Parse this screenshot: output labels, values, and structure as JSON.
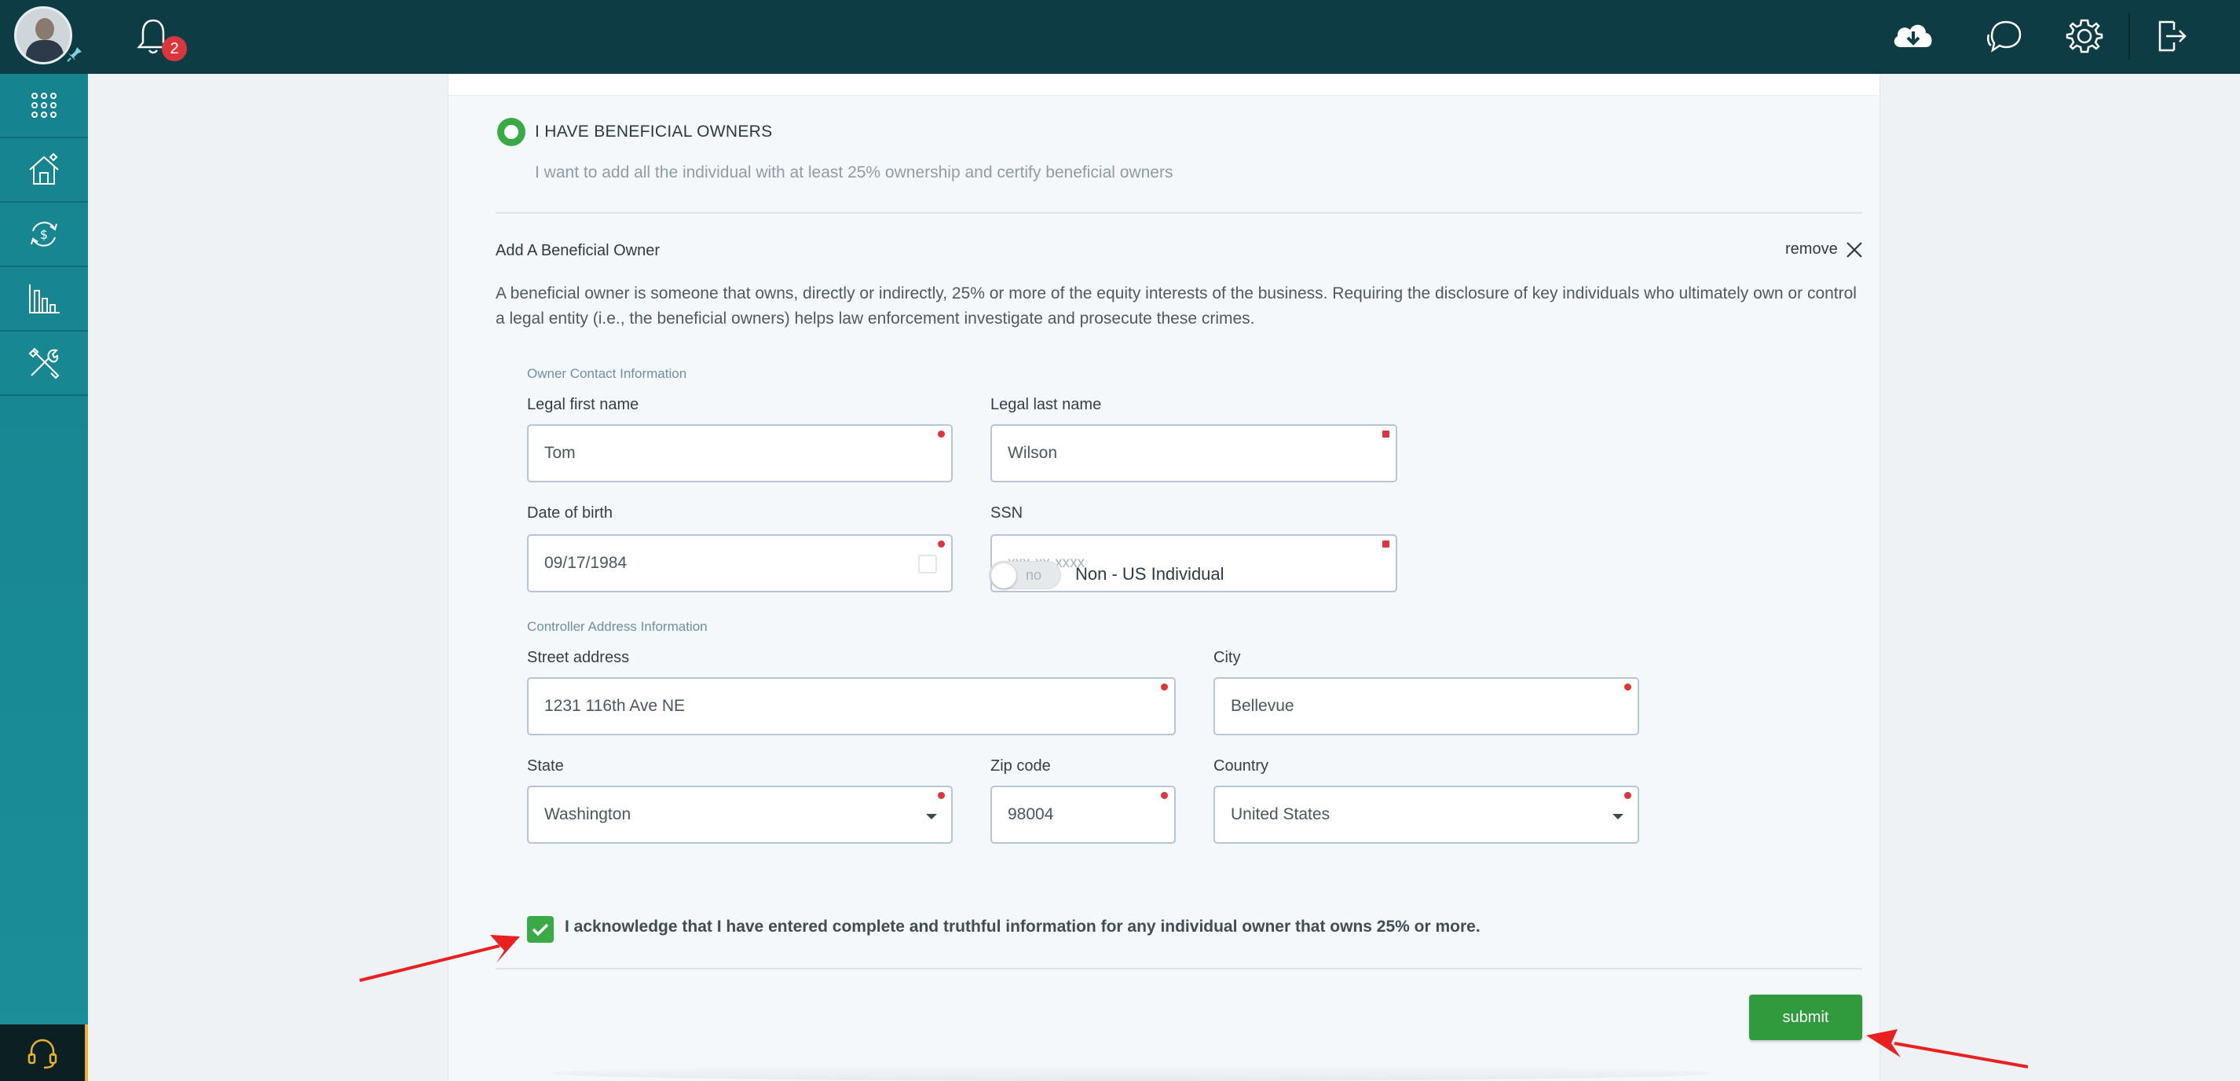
{
  "header": {
    "notification_count": "2",
    "icons": [
      "cloud-download-icon",
      "chat-icon",
      "settings-gear-icon",
      "logout-icon"
    ]
  },
  "sidebar": {
    "items": [
      "apps-grid-icon",
      "home-icon",
      "exchange-icon",
      "analytics-icon",
      "tools-icon"
    ],
    "help_icon": "headset-icon"
  },
  "beneficial": {
    "radio_label": "I HAVE BENEFICIAL OWNERS",
    "radio_description": "I want to add all the individual with at least 25% ownership and certify beneficial owners",
    "section_title": "Add A Beneficial Owner",
    "remove_label": "remove",
    "description": "A beneficial owner is someone that owns, directly or indirectly, 25% or more of the equity interests of the business. Requiring the disclosure of key individuals who ultimately own or control a legal entity (i.e., the beneficial owners) helps law enforcement investigate and prosecute these crimes."
  },
  "contact": {
    "heading": "Owner Contact Information",
    "first_name_label": "Legal first name",
    "first_name_value": "Tom",
    "last_name_label": "Legal last name",
    "last_name_value": "Wilson",
    "dob_label": "Date of birth",
    "dob_value": "09/17/1984",
    "ssn_label": "SSN",
    "ssn_placeholder": "xxx-xx-xxxx",
    "toggle_text": "no",
    "toggle_label": "Non - US Individual"
  },
  "address": {
    "heading": "Controller Address Information",
    "street_label": "Street address",
    "street_value": "1231 116th Ave NE",
    "city_label": "City",
    "city_value": "Bellevue",
    "state_label": "State",
    "state_value": "Washington",
    "zip_label": "Zip code",
    "zip_value": "98004",
    "country_label": "Country",
    "country_value": "United States"
  },
  "acknowledge": {
    "checked": true,
    "text": "I acknowledge that I have entered complete and truthful information for any individual owner that owns 25% or more."
  },
  "actions": {
    "submit_label": "submit"
  },
  "colors": {
    "topbar": "#0e3c44",
    "sidebar": "#16848f",
    "accent_green": "#3aaa47",
    "required_dot": "#e0343c",
    "annotation_arrow": "#e8201f"
  }
}
